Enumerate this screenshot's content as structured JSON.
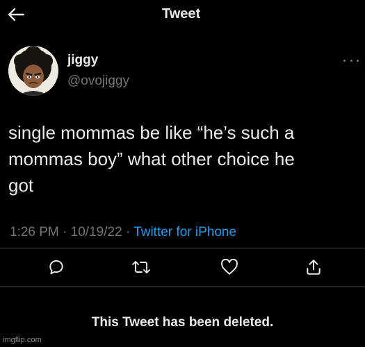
{
  "header": {
    "back_icon": "arrow-left-icon",
    "title": "Tweet"
  },
  "author": {
    "avatar_icon": "cartoon-avatar",
    "display_name": "jiggy",
    "handle": "@ovojiggy",
    "more_icon": "ellipsis-icon"
  },
  "tweet": {
    "lines": [
      "single mommas be like “he’s such a",
      "mommas boy” what other choice he",
      "got"
    ],
    "time": "1:26 PM",
    "date": "10/19/22",
    "separator": "·",
    "source": "Twitter for iPhone"
  },
  "actions": [
    {
      "icon": "reply-icon"
    },
    {
      "icon": "retweet-icon"
    },
    {
      "icon": "like-icon"
    },
    {
      "icon": "share-icon"
    }
  ],
  "notice": "This Tweet has been deleted.",
  "watermark": "imgflip.com",
  "colors": {
    "background": "#000000",
    "text": "#e7e9ea",
    "secondary": "#71767b",
    "link": "#1d9bf0",
    "divider": "#2f3336"
  }
}
